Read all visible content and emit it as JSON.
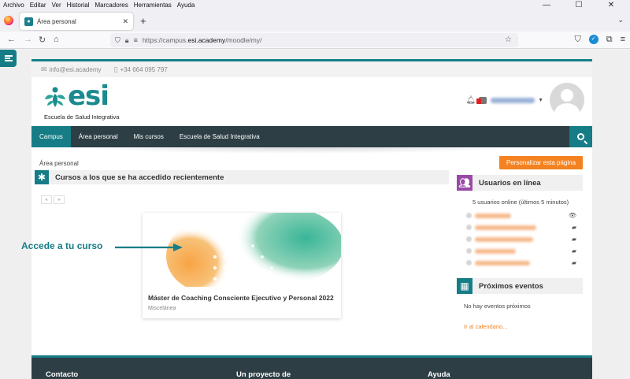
{
  "browser": {
    "menu": [
      "Archivo",
      "Editar",
      "Ver",
      "Historial",
      "Marcadores",
      "Herramientas",
      "Ayuda"
    ],
    "window_controls": {
      "minimize": "—",
      "maximize": "☐",
      "close": "✕"
    },
    "tab": {
      "title": "Área personal",
      "close": "✕"
    },
    "new_tab": "+",
    "tab_list": "⌄",
    "url_prefix": "https://campus.",
    "url_domain": "esi.academy",
    "url_path": "/moodle/my/"
  },
  "site": {
    "topbar": {
      "email": "info@esi.academy",
      "phone": "+34 664 095 797"
    },
    "logo": {
      "word": "esi",
      "subtitle": "Escuela de Salud Integrativa"
    },
    "nav": [
      {
        "label": "Campus",
        "active": true
      },
      {
        "label": "Área personal",
        "active": false
      },
      {
        "label": "Mis cursos",
        "active": false
      },
      {
        "label": "Escuela de Salud Integrativa",
        "active": false
      }
    ],
    "breadcrumb": "Área personal",
    "customize_button": "Personalizar esta página",
    "recent": {
      "title": "Cursos a los que se ha accedido recientemente",
      "pager_prev": "«",
      "pager_next": "»",
      "course": {
        "title": "Máster de Coaching Consciente Ejecutivo y Personal 2022",
        "category": "Miscelánea"
      }
    },
    "callout": "Accede a tu curso",
    "online": {
      "title": "Usuarios en línea",
      "summary": "5 usuarios online (últimos 5 minutos)",
      "users_count": 5
    },
    "events": {
      "title": "Próximos eventos",
      "empty": "No hay eventos próximos",
      "calendar_link": "Ir al calendario..."
    },
    "footer": {
      "col1": "Contacto",
      "col2": "Un proyecto de",
      "col3": "Ayuda"
    }
  },
  "colors": {
    "teal": "#167d87",
    "dark": "#2d3e45",
    "orange": "#f58220",
    "purple": "#9a4aa6"
  }
}
